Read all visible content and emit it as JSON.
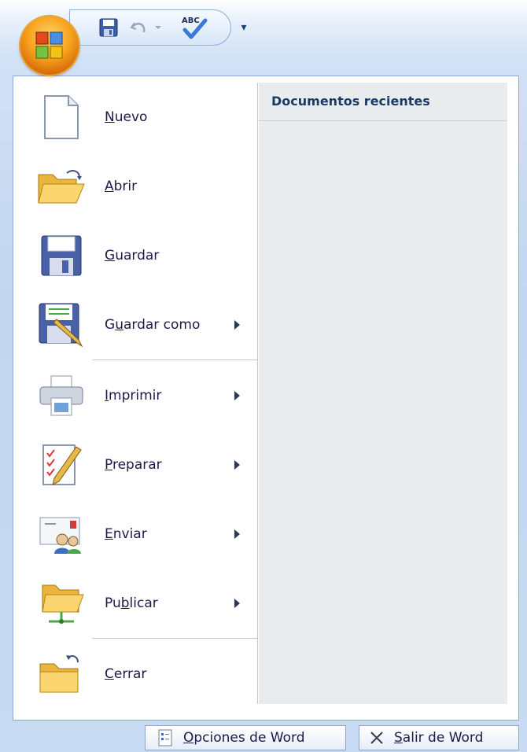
{
  "qat": {
    "save_icon": "save-icon",
    "undo_icon": "undo-icon",
    "spelling_icon": "spelling-check-icon",
    "spelling_label": "ABC",
    "customize_glyph": "▾"
  },
  "office_button": {
    "icon": "office-logo-icon"
  },
  "menu": {
    "items": [
      {
        "pre": "",
        "u": "N",
        "post": "uevo",
        "icon": "new-document-icon",
        "submenu": false
      },
      {
        "pre": "",
        "u": "A",
        "post": "brir",
        "icon": "open-folder-icon",
        "submenu": false
      },
      {
        "pre": "",
        "u": "G",
        "post": "uardar",
        "icon": "save-icon",
        "submenu": false
      },
      {
        "pre": "G",
        "u": "u",
        "post": "ardar como",
        "icon": "save-as-icon",
        "submenu": true
      },
      {
        "pre": "",
        "u": "I",
        "post": "mprimir",
        "icon": "printer-icon",
        "submenu": true
      },
      {
        "pre": "",
        "u": "P",
        "post": "reparar",
        "icon": "prepare-document-icon",
        "submenu": true
      },
      {
        "pre": "",
        "u": "E",
        "post": "nviar",
        "icon": "send-mail-icon",
        "submenu": true
      },
      {
        "pre": "Pu",
        "u": "b",
        "post": "licar",
        "icon": "publish-folder-icon",
        "submenu": true
      },
      {
        "pre": "",
        "u": "C",
        "post": "errar",
        "icon": "close-folder-icon",
        "submenu": false
      }
    ]
  },
  "recent": {
    "title": "Documentos recientes"
  },
  "bottom": {
    "options": {
      "pre": "",
      "u": "O",
      "post": "pciones de Word",
      "icon": "options-icon"
    },
    "exit": {
      "pre": "",
      "u": "S",
      "post": "alir de Word",
      "icon": "close-x-icon"
    }
  },
  "colors": {
    "frame": "#c9dbf2",
    "recent_bg": "#e9ecef",
    "office_orange": "#f7a21d",
    "text": "#1b1b4a",
    "title_text": "#1b3a64"
  }
}
